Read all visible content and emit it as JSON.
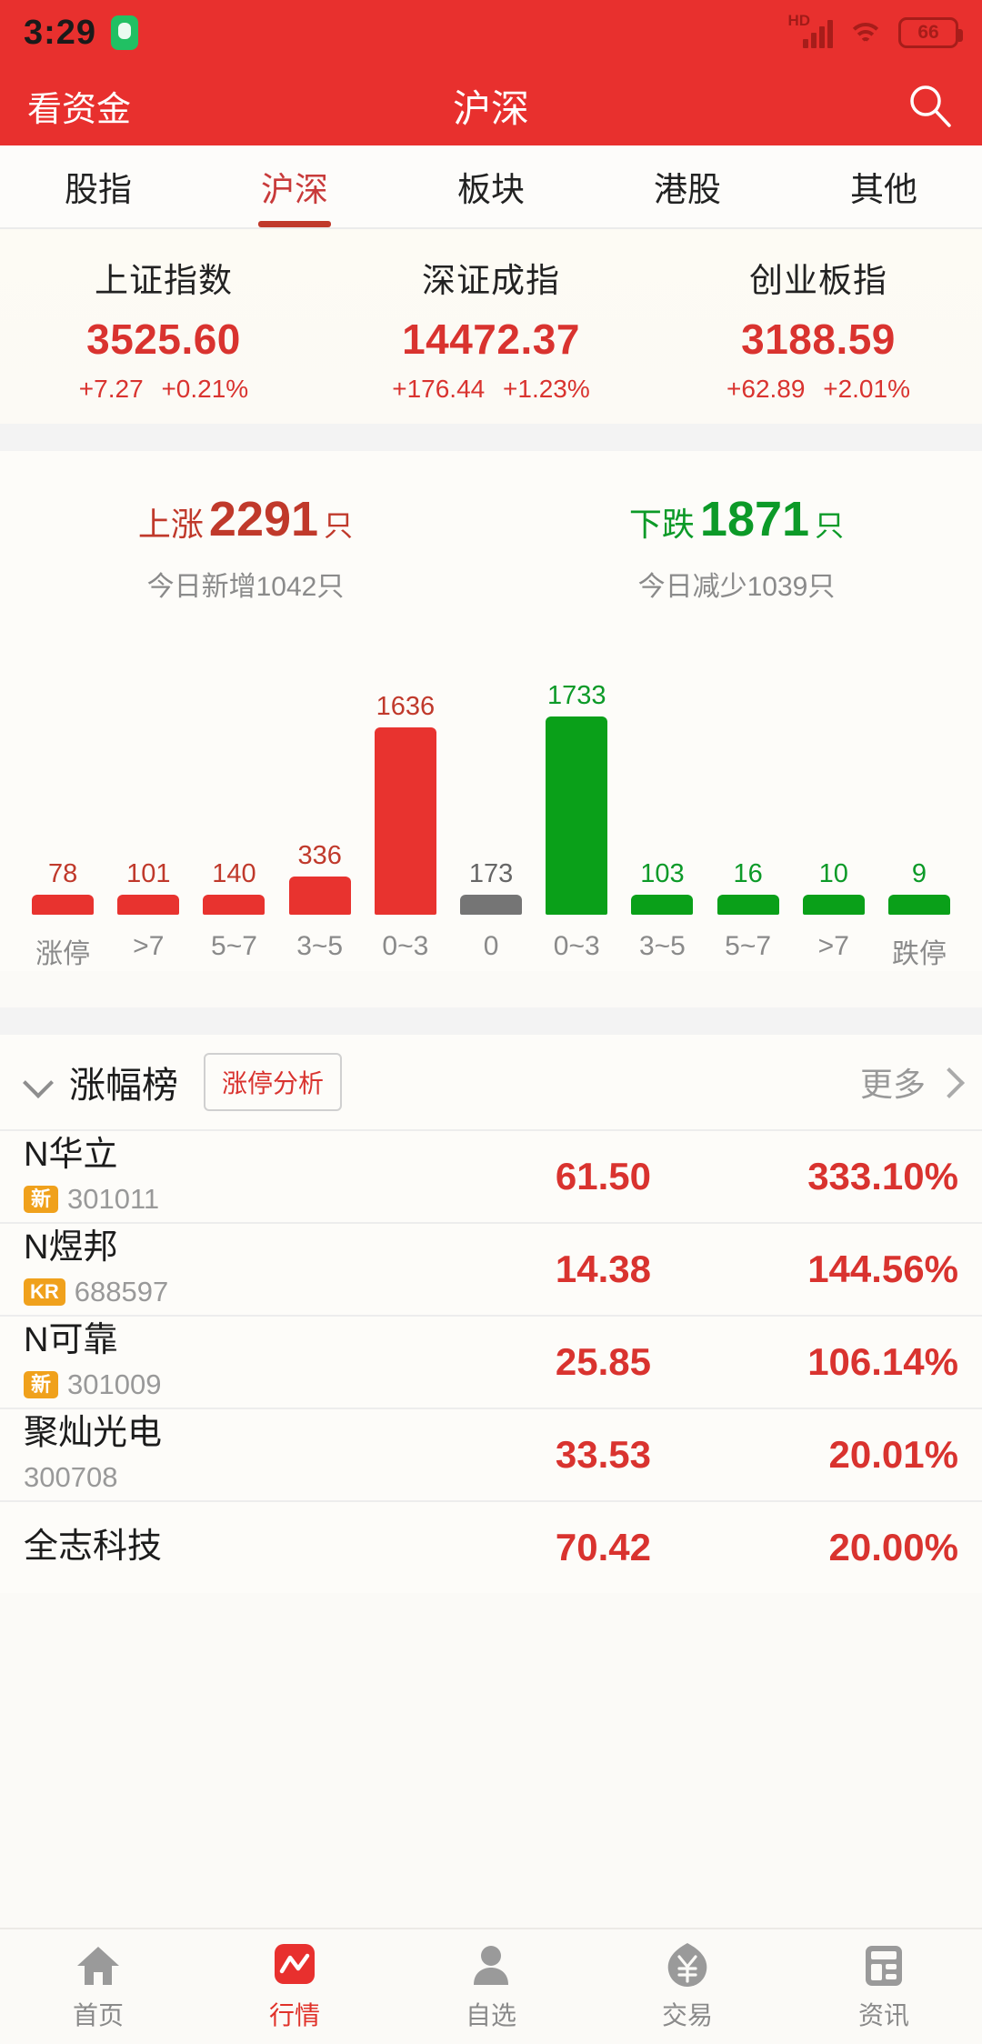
{
  "statusbar": {
    "time": "3:29",
    "hd_label": "HD",
    "battery": "66",
    "icons": [
      "chat-icon",
      "signal-icon",
      "wifi-icon",
      "battery-icon"
    ]
  },
  "header": {
    "left_action": "看资金",
    "title": "沪深",
    "search_icon": "search-icon"
  },
  "tabs": [
    {
      "label": "股指",
      "active": false
    },
    {
      "label": "沪深",
      "active": true
    },
    {
      "label": "板块",
      "active": false
    },
    {
      "label": "港股",
      "active": false
    },
    {
      "label": "其他",
      "active": false
    }
  ],
  "indices": [
    {
      "name": "上证指数",
      "value": "3525.60",
      "change": "+7.27",
      "percent": "+0.21%"
    },
    {
      "name": "深证成指",
      "value": "14472.37",
      "change": "+176.44",
      "percent": "+1.23%"
    },
    {
      "name": "创业板指",
      "value": "3188.59",
      "change": "+62.89",
      "percent": "+2.01%"
    }
  ],
  "breadth": {
    "up": {
      "label": "上涨",
      "count": "2291",
      "unit": "只",
      "sub": "今日新增1042只"
    },
    "down": {
      "label": "下跌",
      "count": "1871",
      "unit": "只",
      "sub": "今日减少1039只"
    }
  },
  "chart_data": {
    "type": "bar",
    "title": "",
    "xlabel": "",
    "ylabel": "",
    "categories": [
      "涨停",
      ">7",
      "5~7",
      "3~5",
      "0~3",
      "0",
      "0~3",
      "3~5",
      "5~7",
      ">7",
      "跌停"
    ],
    "values": [
      78,
      101,
      140,
      336,
      1636,
      173,
      1733,
      103,
      16,
      10,
      9
    ],
    "colors": [
      "#e8332f",
      "#e8332f",
      "#e8332f",
      "#e8332f",
      "#e8332f",
      "#757575",
      "#0aa019",
      "#0aa019",
      "#0aa019",
      "#0aa019",
      "#0aa019"
    ],
    "label_colors": [
      "#c0392b",
      "#c0392b",
      "#c0392b",
      "#c0392b",
      "#c0392b",
      "#666666",
      "#0c9a28",
      "#0c9a28",
      "#0c9a28",
      "#0c9a28",
      "#0c9a28"
    ],
    "ylim": [
      0,
      1733
    ],
    "grid": false,
    "legend": "none"
  },
  "list_header": {
    "chevron_icon": "chevron-down-icon",
    "title": "涨幅榜",
    "button": "涨停分析",
    "more": "更多",
    "more_icon": "chevron-right-icon"
  },
  "stocks": [
    {
      "name": "N华立",
      "badge": "新",
      "code": "301011",
      "price": "61.50",
      "change": "333.10%"
    },
    {
      "name": "N煜邦",
      "badge": "KR",
      "code": "688597",
      "price": "14.38",
      "change": "144.56%"
    },
    {
      "name": "N可靠",
      "badge": "新",
      "code": "301009",
      "price": "25.85",
      "change": "106.14%"
    },
    {
      "name": "聚灿光电",
      "badge": "",
      "code": "300708",
      "price": "33.53",
      "change": "20.01%"
    },
    {
      "name": "全志科技",
      "badge": "",
      "code": "",
      "price": "70.42",
      "change": "20.00%"
    }
  ],
  "bottomnav": [
    {
      "label": "首页",
      "icon": "home-icon",
      "active": false
    },
    {
      "label": "行情",
      "icon": "quotes-icon",
      "active": true
    },
    {
      "label": "自选",
      "icon": "person-icon",
      "active": false
    },
    {
      "label": "交易",
      "icon": "yen-icon",
      "active": false
    },
    {
      "label": "资讯",
      "icon": "news-icon",
      "active": false
    }
  ],
  "colors": {
    "brand_red": "#e8302e",
    "up_red": "#d9332f",
    "down_green": "#0aa019",
    "neutral_gray": "#757575",
    "badge_orange": "#f0a11c"
  }
}
